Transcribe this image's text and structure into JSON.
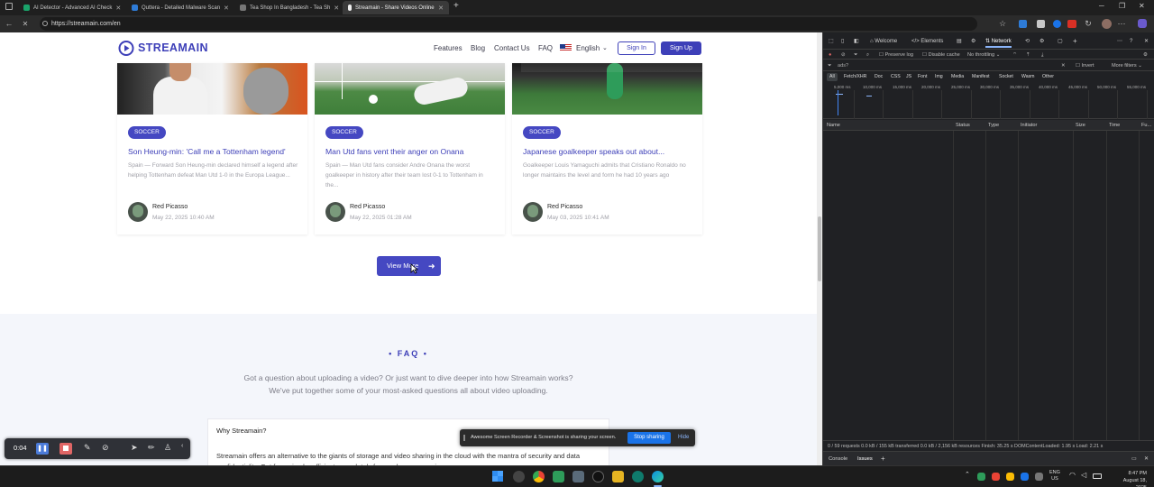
{
  "browser": {
    "tabs": [
      {
        "label": "AI Detector - Advanced AI Check",
        "color": "#1aa36a"
      },
      {
        "label": "Quttera - Detailed Malware Scan",
        "color": "#2e7bd6"
      },
      {
        "label": "Tea Shop In Bangladesh - Tea Sh",
        "color": "#777777"
      },
      {
        "label": "Streamain - Share Videos Online",
        "color": "#ffffff"
      }
    ],
    "url": "https://streamain.com/en"
  },
  "site": {
    "brand": "STREAMAIN",
    "nav": {
      "features": "Features",
      "blog": "Blog",
      "contact": "Contact Us",
      "faq": "FAQ",
      "language": "English"
    },
    "signin": "Sign In",
    "signup": "Sign Up"
  },
  "cards": [
    {
      "badge": "SOCCER",
      "title": "Son Heung-min: 'Call me a Tottenham legend'",
      "desc": "Spain — Forward Son Heung-min declared himself a legend after helping Tottenham defeat Man Utd 1-0 in the Europa League...",
      "author": "Red Picasso",
      "date": "May 22, 2025 10:40 AM"
    },
    {
      "badge": "SOCCER",
      "title": "Man Utd fans vent their anger on Onana",
      "desc": "Spain — Man Utd fans consider Andre Onana the worst goalkeeper in history after their team lost 0-1 to Tottenham in the...",
      "author": "Red Picasso",
      "date": "May 22, 2025 01:28 AM"
    },
    {
      "badge": "SOCCER",
      "title": "Japanese goalkeeper speaks out about...",
      "desc": "Goalkeeper Louis Yamaguchi admits that Cristiano Ronaldo no longer maintains the level and form he had 10 years ago",
      "author": "Red Picasso",
      "date": "May 03, 2025 10:41 AM"
    }
  ],
  "view_more": "View More",
  "faq": {
    "label": "• FAQ •",
    "sub1": "Got a question about uploading a video? Or just want to dive deeper into how Streamain works?",
    "sub2": "We've put together some of your most-asked questions all about video uploading.",
    "question": "Why Streamain?",
    "answer": "Streamain offers an alternative to the giants of storage and video sharing in the cloud with the mantra of security and data confidentiality. Get for a simple, efficient, completely free and secure service."
  },
  "recorder": {
    "time": "0:04"
  },
  "share_notice": {
    "text": "Awesome Screen Recorder & Screenshot is sharing your screen.",
    "stop": "Stop sharing",
    "hide": "Hide"
  },
  "devtools": {
    "tabs": [
      "Welcome",
      "Elements",
      "Network"
    ],
    "preserve_log": "Preserve log",
    "disable_cache": "Disable cache",
    "throttling": "No throttling",
    "filter_value": "ads?",
    "invert": "Invert",
    "more_filters": "More filters",
    "types": [
      "All",
      "Fetch/XHR",
      "Doc",
      "CSS",
      "JS",
      "Font",
      "Img",
      "Media",
      "Manifest",
      "Socket",
      "Wasm",
      "Other"
    ],
    "ticks": [
      "5,000 ms",
      "10,000 ms",
      "15,000 ms",
      "20,000 ms",
      "25,000 ms",
      "30,000 ms",
      "35,000 ms",
      "40,000 ms",
      "45,000 ms",
      "50,000 ms",
      "55,000 ms"
    ],
    "columns": [
      "Name",
      "Status",
      "Type",
      "Initiator",
      "Size",
      "Time",
      "Fu..."
    ],
    "status": "0 / 59 requests   0.0 kB / 155 kB transferred   0.0 kB / 2,156 kB resources   Finish: 35.25 s   DOMContentLoaded: 1.95 s   Load: 2.21 s",
    "drawer_tabs": [
      "Console",
      "Issues"
    ]
  },
  "taskbar": {
    "lang": "ENG",
    "region": "US",
    "time": "8:47 PM",
    "date": "August 18, 2025"
  }
}
